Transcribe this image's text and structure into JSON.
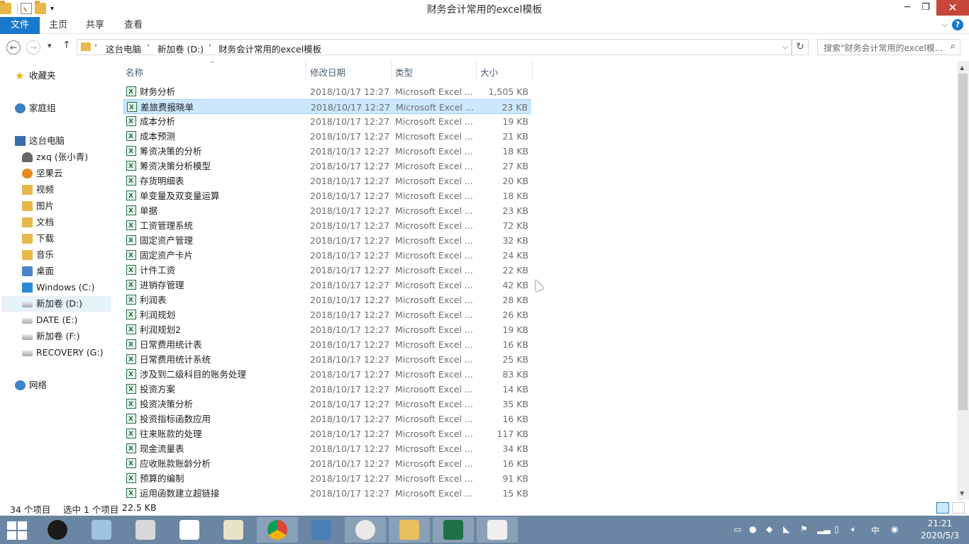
{
  "window": {
    "title": "财务会计常用的excel模板"
  },
  "ribbon": {
    "file_tab": "文件",
    "tabs": [
      "主页",
      "共享",
      "查看"
    ],
    "help_label": "?"
  },
  "address": {
    "crumbs": [
      "这台电脑",
      "新加卷 (D:)",
      "财务会计常用的excel模板"
    ],
    "search_placeholder": "搜索\"财务会计常用的excel模..."
  },
  "nav": {
    "favorites": "收藏夹",
    "homegroup": "家庭组",
    "this_pc": "这台电脑",
    "pc_items": [
      "zxq (张小青)",
      "坚果云",
      "视频",
      "图片",
      "文档",
      "下载",
      "音乐",
      "桌面",
      "Windows (C:)",
      "新加卷 (D:)",
      "DATE (E:)",
      "新加卷 (F:)",
      "RECOVERY (G:)"
    ],
    "network": "网络"
  },
  "columns": {
    "name": "名称",
    "date": "修改日期",
    "type": "类型",
    "size": "大小"
  },
  "files": [
    {
      "name": "财务分析",
      "date": "2018/10/17 12:27",
      "type": "Microsoft Excel ...",
      "size": "1,505 KB"
    },
    {
      "name": "差旅费报晓单",
      "date": "2018/10/17 12:27",
      "type": "Microsoft Excel ...",
      "size": "23 KB"
    },
    {
      "name": "成本分析",
      "date": "2018/10/17 12:27",
      "type": "Microsoft Excel ...",
      "size": "19 KB"
    },
    {
      "name": "成本预测",
      "date": "2018/10/17 12:27",
      "type": "Microsoft Excel ...",
      "size": "21 KB"
    },
    {
      "name": "筹资决策的分析",
      "date": "2018/10/17 12:27",
      "type": "Microsoft Excel ...",
      "size": "18 KB"
    },
    {
      "name": "筹资决策分析模型",
      "date": "2018/10/17 12:27",
      "type": "Microsoft Excel ...",
      "size": "27 KB"
    },
    {
      "name": "存货明细表",
      "date": "2018/10/17 12:27",
      "type": "Microsoft Excel ...",
      "size": "20 KB"
    },
    {
      "name": "单变量及双变量运算",
      "date": "2018/10/17 12:27",
      "type": "Microsoft Excel ...",
      "size": "18 KB"
    },
    {
      "name": "单据",
      "date": "2018/10/17 12:27",
      "type": "Microsoft Excel ...",
      "size": "23 KB"
    },
    {
      "name": "工资管理系统",
      "date": "2018/10/17 12:27",
      "type": "Microsoft Excel ...",
      "size": "72 KB"
    },
    {
      "name": "固定资产管理",
      "date": "2018/10/17 12:27",
      "type": "Microsoft Excel ...",
      "size": "32 KB"
    },
    {
      "name": "固定资产卡片",
      "date": "2018/10/17 12:27",
      "type": "Microsoft Excel ...",
      "size": "24 KB"
    },
    {
      "name": "计件工资",
      "date": "2018/10/17 12:27",
      "type": "Microsoft Excel ...",
      "size": "22 KB"
    },
    {
      "name": "进销存管理",
      "date": "2018/10/17 12:27",
      "type": "Microsoft Excel ...",
      "size": "42 KB"
    },
    {
      "name": "利润表",
      "date": "2018/10/17 12:27",
      "type": "Microsoft Excel ...",
      "size": "28 KB"
    },
    {
      "name": "利润规划",
      "date": "2018/10/17 12:27",
      "type": "Microsoft Excel ...",
      "size": "26 KB"
    },
    {
      "name": "利润规划2",
      "date": "2018/10/17 12:27",
      "type": "Microsoft Excel ...",
      "size": "19 KB"
    },
    {
      "name": "日常费用统计表",
      "date": "2018/10/17 12:27",
      "type": "Microsoft Excel ...",
      "size": "16 KB"
    },
    {
      "name": "日常费用统计系统",
      "date": "2018/10/17 12:27",
      "type": "Microsoft Excel ...",
      "size": "25 KB"
    },
    {
      "name": "涉及到二级科目的账务处理",
      "date": "2018/10/17 12:27",
      "type": "Microsoft Excel ...",
      "size": "83 KB"
    },
    {
      "name": "投资方案",
      "date": "2018/10/17 12:27",
      "type": "Microsoft Excel ...",
      "size": "14 KB"
    },
    {
      "name": "投资决策分析",
      "date": "2018/10/17 12:27",
      "type": "Microsoft Excel ...",
      "size": "35 KB"
    },
    {
      "name": "投资指标函数应用",
      "date": "2018/10/17 12:27",
      "type": "Microsoft Excel ...",
      "size": "16 KB"
    },
    {
      "name": "往来账款的处理",
      "date": "2018/10/17 12:27",
      "type": "Microsoft Excel ...",
      "size": "117 KB"
    },
    {
      "name": "现金流量表",
      "date": "2018/10/17 12:27",
      "type": "Microsoft Excel ...",
      "size": "34 KB"
    },
    {
      "name": "应收账款账龄分析",
      "date": "2018/10/17 12:27",
      "type": "Microsoft Excel ...",
      "size": "16 KB"
    },
    {
      "name": "预算的编制",
      "date": "2018/10/17 12:27",
      "type": "Microsoft Excel ...",
      "size": "91 KB"
    },
    {
      "name": "运用函数建立超链接",
      "date": "2018/10/17 12:27",
      "type": "Microsoft Excel ...",
      "size": "15 KB"
    }
  ],
  "selected_file": "差旅费报晓单",
  "status": {
    "count": "34 个项目",
    "selected": "选中 1 个项目",
    "size": "22.5 KB"
  },
  "taskbar": {
    "apps": [
      "qq-icon",
      "notepad-icon",
      "rocket-icon",
      "baidu-netdisk-icon",
      "pen-icon",
      "chrome-icon",
      "boat-icon",
      "wechat-icon",
      "explorer-icon",
      "excel-icon",
      "screen-icon"
    ],
    "ime": "中",
    "time": "21:21",
    "date": "2020/5/3"
  },
  "colors": {
    "accent": "#1979ca",
    "selection": "#cce8ff",
    "taskbar": "#6a86a3",
    "close": "#c7463a"
  }
}
